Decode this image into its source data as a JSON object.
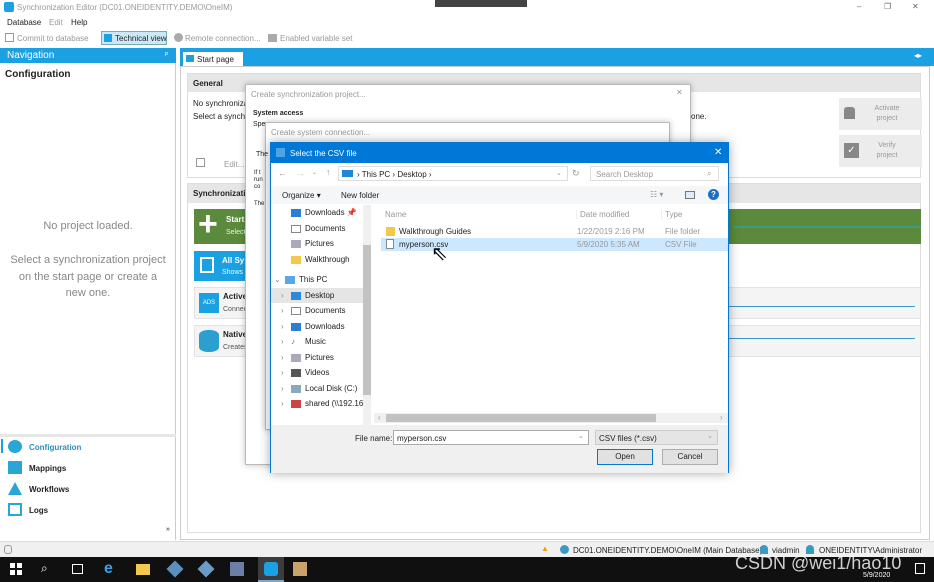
{
  "window": {
    "title": "Synchronization Editor (DC01.ONEIDENTITY.DEMO\\OneIM)",
    "controls": [
      "–",
      "❐",
      "✕"
    ]
  },
  "menu": [
    "Database",
    "Edit",
    "Help"
  ],
  "toolbar": {
    "commit": "Commit to database",
    "technical_view": "Technical view",
    "remote": "Remote connection...",
    "variable_set": "Enabled variable set"
  },
  "navigation": {
    "header": "Navigation",
    "section": "Configuration",
    "no_project": "No project loaded.",
    "hint": "Select a synchronization project on the start page or create a new one.",
    "items": [
      {
        "label": "Configuration",
        "icon": "gear-icon"
      },
      {
        "label": "Mappings",
        "icon": "mappings-icon"
      },
      {
        "label": "Workflows",
        "icon": "workflow-icon"
      },
      {
        "label": "Logs",
        "icon": "logs-icon"
      }
    ]
  },
  "start_page": {
    "tab": "Start page",
    "general": "General",
    "line1": "No synchroniza",
    "line2": "Select a synchr",
    "line2_end": "one.",
    "edit": "Edit...",
    "activate": "Activate project",
    "verify": "Verify project",
    "sync_header": "Synchronizati",
    "tiles": [
      {
        "title": "Start",
        "sub": "Select"
      },
      {
        "title": "All Sy",
        "sub": "Shows t"
      },
      {
        "title": "Active",
        "sub": "Connec",
        "badge": "ADS"
      },
      {
        "title": "Native",
        "sub": "Creates"
      }
    ]
  },
  "dialog_project": {
    "title": "Create synchronization project...",
    "system_access": "System access",
    "spec": "Spe",
    "the1": "The",
    "if": "If t",
    "run": "run",
    "con": "co",
    "the2": "The"
  },
  "dialog_connection": {
    "title": "Create system connection..."
  },
  "file_dialog": {
    "title": "Select the CSV file",
    "path": [
      "This PC",
      "Desktop"
    ],
    "search_placeholder": "Search Desktop",
    "organize": "Organize",
    "new_folder": "New folder",
    "quick": [
      {
        "label": "Downloads"
      },
      {
        "label": "Documents"
      },
      {
        "label": "Pictures"
      },
      {
        "label": "Walkthrough"
      }
    ],
    "this_pc": "This PC",
    "tree": [
      "Desktop",
      "Documents",
      "Downloads",
      "Music",
      "Pictures",
      "Videos",
      "Local Disk (C:)",
      "shared (\\\\192.16"
    ],
    "columns": [
      "Name",
      "Date modified",
      "Type"
    ],
    "files": [
      {
        "name": "Walkthrough Guides",
        "date": "1/22/2019 2:16 PM",
        "type": "File folder"
      },
      {
        "name": "myperson.csv",
        "date": "5/9/2020 5:35 AM",
        "type": "CSV File"
      }
    ],
    "filename_label": "File name:",
    "filename": "myperson.csv",
    "filter": "CSV files (*.csv)",
    "open": "Open",
    "cancel": "Cancel"
  },
  "status": {
    "db": "DC01.ONEIDENTITY.DEMO\\OneIM (Main Database)",
    "user1": "viadmin",
    "user2": "ONEIDENTITY\\Administrator"
  },
  "taskbar": {
    "date": "5/9/2020",
    "watermark": "CSDN @wei1/hao10"
  },
  "colors": {
    "accent": "#1ba1e2",
    "dialog_title": "#0078d7",
    "green": "#5b8a3c"
  }
}
